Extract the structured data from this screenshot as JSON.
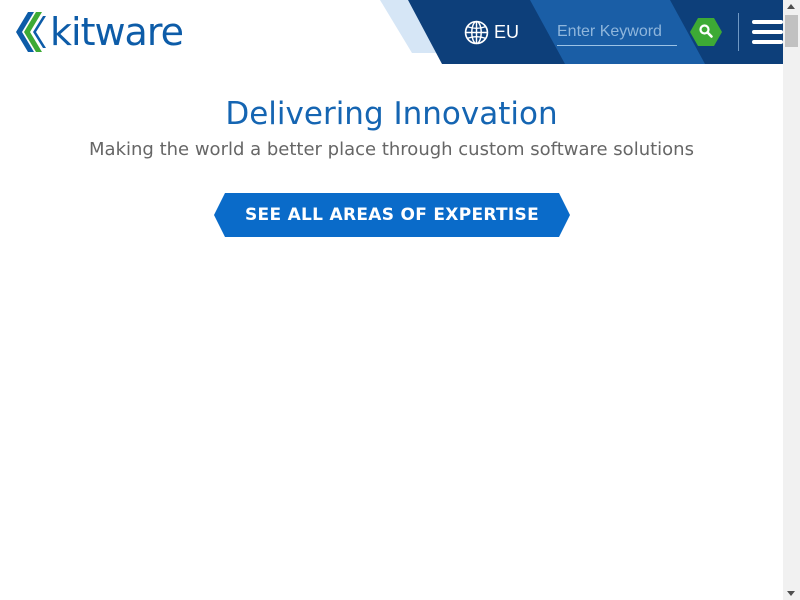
{
  "header": {
    "logo_text": "kitware",
    "region_label": "EU",
    "search_placeholder": "Enter Keyword"
  },
  "hero": {
    "title": "Delivering Innovation",
    "subtitle": "Making the world a better place through custom software solutions",
    "cta_label": "SEE ALL AREAS OF EXPERTISE"
  },
  "colors": {
    "brand_blue": "#0d5ca8",
    "header_dark": "#0d3f7a",
    "header_mid": "#1a5ea6",
    "accent_green": "#3daa35",
    "cta_blue": "#0a6bc9"
  },
  "icons": {
    "logo_mark": "kitware-chevron-logo-icon",
    "region": "globe-icon",
    "search": "magnifier-icon",
    "menu": "hamburger-menu-icon"
  }
}
